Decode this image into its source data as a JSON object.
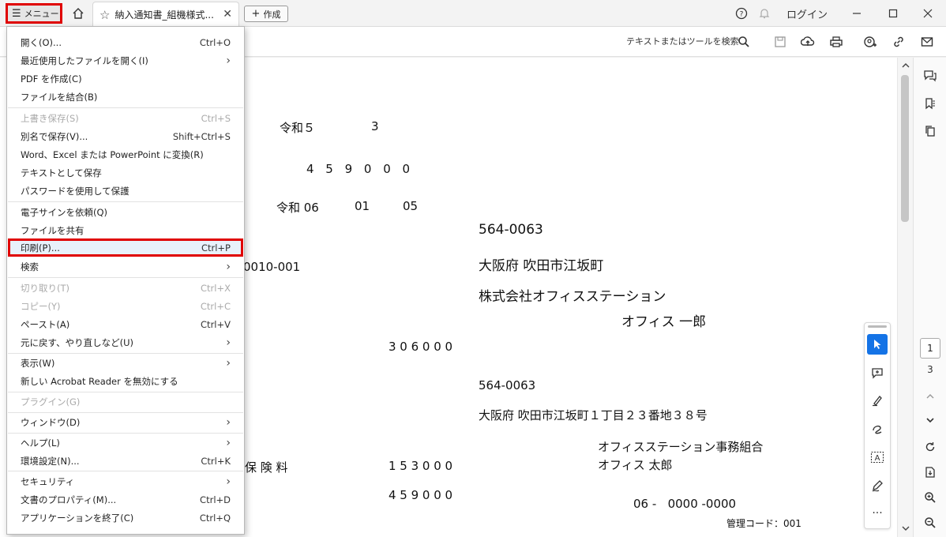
{
  "titlebar": {
    "menu_label": "メニュー",
    "tab_title": "納入通知書_組機様式...",
    "create_label": "作成",
    "login_label": "ログイン"
  },
  "toolbar": {
    "search_label": "テキストまたはツールを検索"
  },
  "menu": {
    "items": [
      {
        "label": "開く(O)...",
        "shortcut": "Ctrl+O",
        "submenu": false,
        "disabled": false
      },
      {
        "label": "最近使用したファイルを開く(I)",
        "shortcut": "",
        "submenu": true,
        "disabled": false
      },
      {
        "label": "PDF を作成(C)",
        "shortcut": "",
        "submenu": false,
        "disabled": false
      },
      {
        "label": "ファイルを結合(B)",
        "shortcut": "",
        "submenu": false,
        "disabled": false
      },
      {
        "label": "上書き保存(S)",
        "shortcut": "Ctrl+S",
        "submenu": false,
        "disabled": true
      },
      {
        "label": "別名で保存(V)...",
        "shortcut": "Shift+Ctrl+S",
        "submenu": false,
        "disabled": false
      },
      {
        "label": "Word、Excel または PowerPoint に変換(R)",
        "shortcut": "",
        "submenu": false,
        "disabled": false
      },
      {
        "label": "テキストとして保存",
        "shortcut": "",
        "submenu": false,
        "disabled": false
      },
      {
        "label": "パスワードを使用して保護",
        "shortcut": "",
        "submenu": false,
        "disabled": false
      },
      {
        "label": "電子サインを依頼(Q)",
        "shortcut": "",
        "submenu": false,
        "disabled": false
      },
      {
        "label": "ファイルを共有",
        "shortcut": "",
        "submenu": false,
        "disabled": false
      },
      {
        "label": "印刷(P)...",
        "shortcut": "Ctrl+P",
        "submenu": false,
        "disabled": false
      },
      {
        "label": "検索",
        "shortcut": "",
        "submenu": true,
        "disabled": false
      },
      {
        "label": "切り取り(T)",
        "shortcut": "Ctrl+X",
        "submenu": false,
        "disabled": true
      },
      {
        "label": "コピー(Y)",
        "shortcut": "Ctrl+C",
        "submenu": false,
        "disabled": true
      },
      {
        "label": "ペースト(A)",
        "shortcut": "Ctrl+V",
        "submenu": false,
        "disabled": false
      },
      {
        "label": "元に戻す、やり直しなど(U)",
        "shortcut": "",
        "submenu": true,
        "disabled": false
      },
      {
        "label": "表示(W)",
        "shortcut": "",
        "submenu": true,
        "disabled": false
      },
      {
        "label": "新しい Acrobat Reader を無効にする",
        "shortcut": "",
        "submenu": false,
        "disabled": false
      },
      {
        "label": "プラグイン(G)",
        "shortcut": "",
        "submenu": false,
        "disabled": true
      },
      {
        "label": "ウィンドウ(D)",
        "shortcut": "",
        "submenu": true,
        "disabled": false
      },
      {
        "label": "ヘルプ(L)",
        "shortcut": "",
        "submenu": true,
        "disabled": false
      },
      {
        "label": "環境設定(N)...",
        "shortcut": "Ctrl+K",
        "submenu": false,
        "disabled": false
      },
      {
        "label": "セキュリティ",
        "shortcut": "",
        "submenu": true,
        "disabled": false
      },
      {
        "label": "文書のプロパティ(M)...",
        "shortcut": "Ctrl+D",
        "submenu": false,
        "disabled": false
      },
      {
        "label": "アプリケーションを終了(C)",
        "shortcut": "Ctrl+Q",
        "submenu": false,
        "disabled": false
      }
    ]
  },
  "document": {
    "era1": "令和５",
    "month1": "3",
    "amount_top": "4 5 9 0 0 0",
    "era2": "令和 06",
    "month2": "01",
    "day2": "05",
    "zip1": "564-0063",
    "code": "0010-001",
    "addr1": "大阪府 吹田市江坂町",
    "company1": "株式会社オフィスステーション",
    "person1": "オフィス 一郎",
    "amount1": "3 0 6 0 0 0",
    "zip2": "564-0063",
    "addr2": "大阪府 吹田市江坂町１丁目２３番地３８号",
    "company2": "オフィスステーション事務組合",
    "person2": "オフィス 太郎",
    "insurance_label": "保 険 料",
    "amount2": "1 5 3 0 0 0",
    "amount3": "4 5 9 0 0 0",
    "phone": "06 -   0000 -0000",
    "management_code": "管理コード：001"
  },
  "page_nav": {
    "current": "1",
    "total": "3"
  }
}
